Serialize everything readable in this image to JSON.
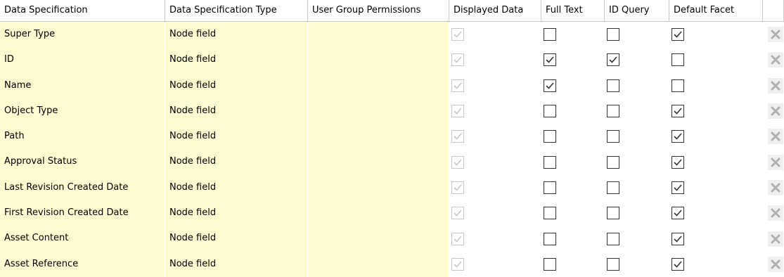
{
  "columns": [
    "Data Specification",
    "Data Specification Type",
    "User Group Permissions",
    "Displayed Data",
    "Full Text",
    "ID Query",
    "Default Facet",
    ""
  ],
  "rows": [
    {
      "spec": "Super Type",
      "type": "Node field",
      "perm": "",
      "displayed": true,
      "full_text": false,
      "id_query": false,
      "default_facet": true
    },
    {
      "spec": "ID",
      "type": "Node field",
      "perm": "",
      "displayed": true,
      "full_text": true,
      "id_query": true,
      "default_facet": false
    },
    {
      "spec": "Name",
      "type": "Node field",
      "perm": "",
      "displayed": true,
      "full_text": true,
      "id_query": false,
      "default_facet": false
    },
    {
      "spec": "Object Type",
      "type": "Node field",
      "perm": "",
      "displayed": true,
      "full_text": false,
      "id_query": false,
      "default_facet": true
    },
    {
      "spec": "Path",
      "type": "Node field",
      "perm": "",
      "displayed": true,
      "full_text": false,
      "id_query": false,
      "default_facet": true
    },
    {
      "spec": "Approval Status",
      "type": "Node field",
      "perm": "",
      "displayed": true,
      "full_text": false,
      "id_query": false,
      "default_facet": true
    },
    {
      "spec": "Last Revision Created Date",
      "type": "Node field",
      "perm": "",
      "displayed": true,
      "full_text": false,
      "id_query": false,
      "default_facet": true
    },
    {
      "spec": "First Revision Created Date",
      "type": "Node field",
      "perm": "",
      "displayed": true,
      "full_text": false,
      "id_query": false,
      "default_facet": true
    },
    {
      "spec": "Asset Content",
      "type": "Node field",
      "perm": "",
      "displayed": true,
      "full_text": false,
      "id_query": false,
      "default_facet": true
    },
    {
      "spec": "Asset Reference",
      "type": "Node field",
      "perm": "",
      "displayed": true,
      "full_text": false,
      "id_query": false,
      "default_facet": true
    }
  ],
  "colors": {
    "editable_bg": "#fffcd2",
    "grid_line": "#c8c8c8",
    "disabled_check": "#c8c8c8",
    "delete_icon": "#b0b0b0"
  },
  "icons": {
    "delete": "close-x-icon",
    "check": "checkmark-icon"
  }
}
